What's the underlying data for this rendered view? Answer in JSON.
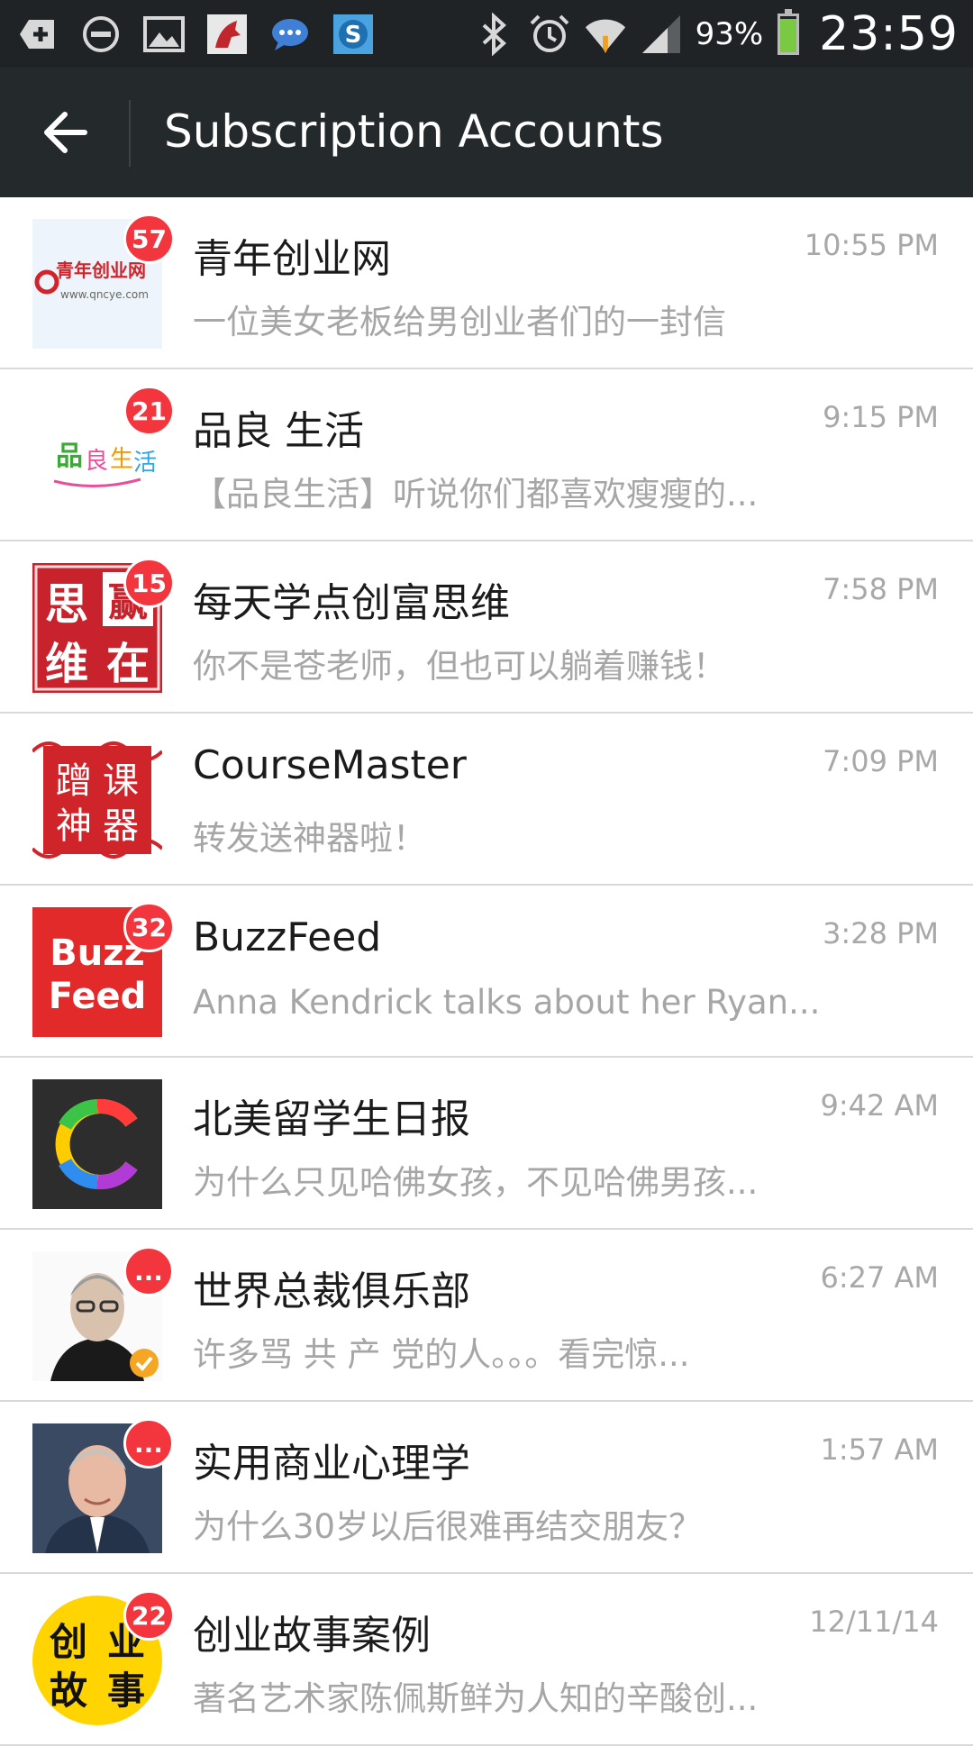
{
  "status_bar": {
    "battery_percent": "93%",
    "battery_level": 0.93,
    "time": "23:59",
    "left_icons": [
      "add-icon",
      "do-not-disturb-icon",
      "gallery-icon",
      "app-notification-icon",
      "chat-notification-icon",
      "skype-icon"
    ],
    "right_icons": [
      "bluetooth-icon",
      "alarm-icon",
      "wifi-icon",
      "signal-icon",
      "battery-icon"
    ]
  },
  "app_bar": {
    "title": "Subscription Accounts",
    "back_icon": "arrow-left-icon"
  },
  "accounts": [
    {
      "name": "青年创业网",
      "time": "10:55 PM",
      "preview": "一位美女老板给男创业者们的一封信",
      "badge": "57",
      "avatar_text": "青年创业网",
      "avatar_subtext": "www.qncye.com",
      "avatar_bg": "#eef4fb"
    },
    {
      "name": "品良 生活",
      "time": "9:15 PM",
      "preview": "【品良生活】听说你们都喜欢瘦瘦的...",
      "badge": "21",
      "avatar_text": "品良生活",
      "avatar_bg": "#ffffff"
    },
    {
      "name": "每天学点创富思维",
      "time": "7:58 PM",
      "preview": "你不是苍老师，但也可以躺着赚钱！",
      "badge": "15",
      "avatar_text": "思赢维在",
      "avatar_bg": "#c8232c"
    },
    {
      "name": "CourseMaster",
      "time": "7:09 PM",
      "preview": "转发送神器啦！",
      "badge": "",
      "avatar_text": "蹭课神器",
      "avatar_bg": "#d0242b"
    },
    {
      "name": "BuzzFeed",
      "time": "3:28 PM",
      "preview": "Anna Kendrick talks about her Ryan...",
      "badge": "32",
      "avatar_text": "Buzz Feed",
      "avatar_bg": "#e32a2a"
    },
    {
      "name": "北美留学生日报",
      "time": "9:42 AM",
      "preview": "为什么只见哈佛女孩，不见哈佛男孩...",
      "badge": "",
      "avatar_text": "C",
      "avatar_bg": "#2d2d2d"
    },
    {
      "name": "世界总裁俱乐部",
      "time": "6:27 AM",
      "preview": "许多骂 共  产  党的人。。。看完惊...",
      "badge": "...",
      "avatar_text": "",
      "avatar_bg": "#f2f2f2"
    },
    {
      "name": "实用商业心理学",
      "time": "1:57 AM",
      "preview": "为什么30岁以后很难再结交朋友？",
      "badge": "...",
      "avatar_text": "",
      "avatar_bg": "#3a4a63"
    },
    {
      "name": "创业故事案例",
      "time": "12/11/14",
      "preview": "著名艺术家陈佩斯鲜为人知的辛酸创...",
      "badge": "22",
      "avatar_text": "创业故事",
      "avatar_bg": "#ffd400"
    }
  ]
}
